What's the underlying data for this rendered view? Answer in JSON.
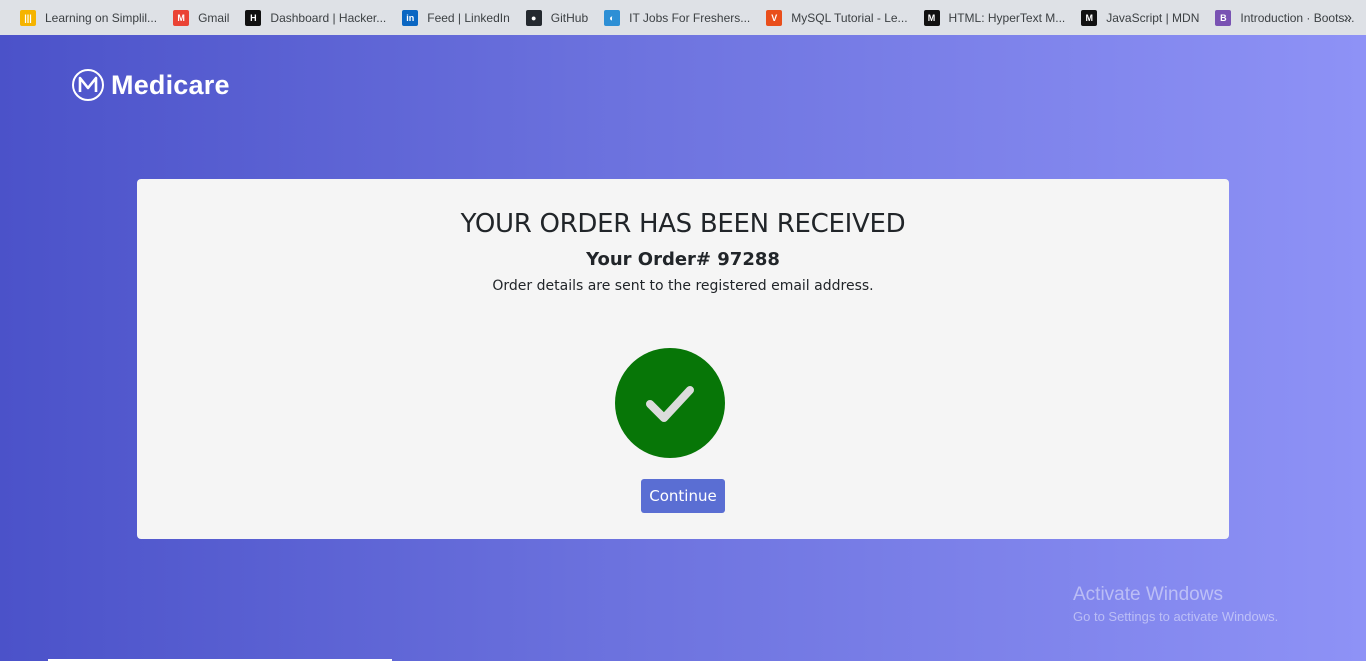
{
  "bookmarks": [
    {
      "label": "Learning on Simplil...",
      "icon": "simplilearn-icon",
      "color": "#f5b400",
      "glyph": "|||"
    },
    {
      "label": "Gmail",
      "icon": "gmail-icon",
      "color": "#ea4335",
      "glyph": "M"
    },
    {
      "label": "Dashboard | Hacker...",
      "icon": "hackerrank-icon",
      "color": "#111111",
      "glyph": "H"
    },
    {
      "label": "Feed | LinkedIn",
      "icon": "linkedin-icon",
      "color": "#0a66c2",
      "glyph": "in"
    },
    {
      "label": "GitHub",
      "icon": "github-icon",
      "color": "#24292f",
      "glyph": "●"
    },
    {
      "label": "IT Jobs For Freshers...",
      "icon": "itjobs-icon",
      "color": "#2d8fd5",
      "glyph": "◐"
    },
    {
      "label": "MySQL Tutorial - Le...",
      "icon": "mysqltutorial-icon",
      "color": "#e94e1b",
      "glyph": "V"
    },
    {
      "label": "HTML: HyperText M...",
      "icon": "mdn-icon",
      "color": "#111111",
      "glyph": "M"
    },
    {
      "label": "JavaScript | MDN",
      "icon": "mdn-icon",
      "color": "#111111",
      "glyph": "M"
    },
    {
      "label": "Introduction · Boots...",
      "icon": "bootstrap-icon",
      "color": "#7952b3",
      "glyph": "B"
    }
  ],
  "bookmarks_more": "»",
  "brand": {
    "name": "Medicare"
  },
  "order": {
    "heading": "YOUR ORDER HAS BEEN RECEIVED",
    "number_label": "Your Order# 97288",
    "message": "Order details are sent to the registered email address.",
    "button": "Continue"
  },
  "watermark": {
    "line1": "Activate Windows",
    "line2": "Go to Settings to activate Windows."
  },
  "colors": {
    "success": "#077607",
    "button": "#5a6ed3",
    "gradient_start": "#4b52c9",
    "gradient_end": "#8e92f6"
  }
}
